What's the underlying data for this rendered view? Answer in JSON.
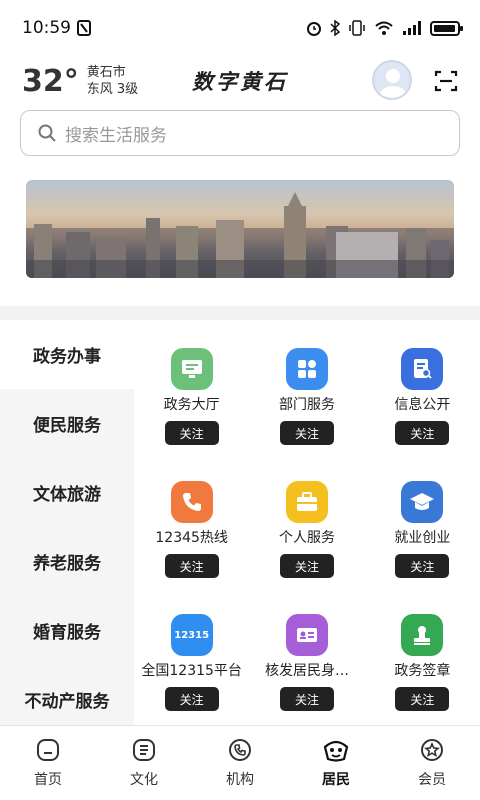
{
  "status": {
    "time": "10:59",
    "nfc_icon": "nfc-icon",
    "alarm_icon": "alarm-icon",
    "bluetooth_icon": "bluetooth-icon",
    "vibrate_icon": "vibrate-icon",
    "wifi_icon": "wifi-icon",
    "signal_icon": "signal-icon",
    "battery_icon": "battery-icon"
  },
  "header": {
    "temperature": "32°",
    "city": "黄石市",
    "wind": "东风  3级",
    "app_title": "数字黄石"
  },
  "search": {
    "placeholder": "搜索生活服务"
  },
  "sidebar": {
    "items": [
      {
        "label": "政务办事",
        "active": true
      },
      {
        "label": "便民服务"
      },
      {
        "label": "文体旅游"
      },
      {
        "label": "养老服务"
      },
      {
        "label": "婚育服务"
      },
      {
        "label": "不动产服务"
      }
    ]
  },
  "services": [
    {
      "label": "政务大厅",
      "icon": "monitor-icon",
      "color": "#6cc07a",
      "follow": "关注"
    },
    {
      "label": "部门服务",
      "icon": "apps-icon",
      "color": "#3c8df0",
      "follow": "关注"
    },
    {
      "label": "信息公开",
      "icon": "document-search-icon",
      "color": "#3a6fe0",
      "follow": "关注"
    },
    {
      "label": "12345热线",
      "icon": "phone-icon",
      "color": "#f07a3e",
      "follow": "关注"
    },
    {
      "label": "个人服务",
      "icon": "briefcase-icon",
      "color": "#f5c01f",
      "follow": "关注"
    },
    {
      "label": "就业创业",
      "icon": "graduation-cap-icon",
      "color": "#3a78d8",
      "follow": "关注"
    },
    {
      "label": "全国12315平台",
      "icon": "badge-12315-icon",
      "icon_text": "12315",
      "color": "#2f8ef0",
      "follow": "关注"
    },
    {
      "label": "核发居民身…",
      "icon": "id-card-icon",
      "color": "#a55dd8",
      "follow": "关注"
    },
    {
      "label": "政务签章",
      "icon": "stamp-icon",
      "color": "#35a853",
      "follow": "关注"
    }
  ],
  "tabbar": {
    "tabs": [
      {
        "label": "首页",
        "icon": "home-icon"
      },
      {
        "label": "文化",
        "icon": "culture-icon"
      },
      {
        "label": "机构",
        "icon": "institution-icon"
      },
      {
        "label": "居民",
        "icon": "resident-icon",
        "active": true
      },
      {
        "label": "会员",
        "icon": "member-icon"
      }
    ]
  }
}
